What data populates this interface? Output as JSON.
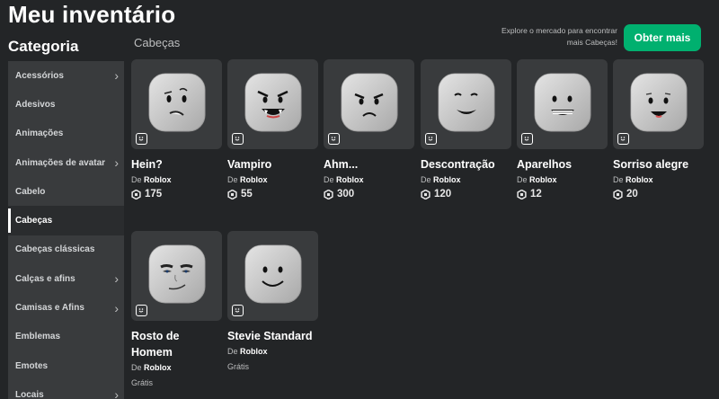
{
  "page": {
    "title": "Meu inventário"
  },
  "sidebar": {
    "title": "Categoria",
    "items": [
      {
        "label": "Acessórios",
        "chevron": true,
        "active": false
      },
      {
        "label": "Adesivos",
        "chevron": false,
        "active": false
      },
      {
        "label": "Animações",
        "chevron": false,
        "active": false
      },
      {
        "label": "Animações de avatar",
        "chevron": true,
        "active": false
      },
      {
        "label": "Cabelo",
        "chevron": false,
        "active": false
      },
      {
        "label": "Cabeças",
        "chevron": false,
        "active": true
      },
      {
        "label": "Cabeças clássicas",
        "chevron": false,
        "active": false
      },
      {
        "label": "Calças e afins",
        "chevron": true,
        "active": false
      },
      {
        "label": "Camisas e Afins",
        "chevron": true,
        "active": false
      },
      {
        "label": "Emblemas",
        "chevron": false,
        "active": false
      },
      {
        "label": "Emotes",
        "chevron": false,
        "active": false
      },
      {
        "label": "Locais",
        "chevron": true,
        "active": false
      }
    ]
  },
  "main": {
    "section_title": "Cabeças",
    "promo_text": "Explore o mercado para encontrar mais Cabeças!",
    "get_more_label": "Obter mais",
    "creator_prefix": "De",
    "items": [
      {
        "name": "Hein?",
        "creator": "Roblox",
        "price": "175",
        "face": "hein"
      },
      {
        "name": "Vampiro",
        "creator": "Roblox",
        "price": "55",
        "face": "vampiro"
      },
      {
        "name": "Ahm...",
        "creator": "Roblox",
        "price": "300",
        "face": "ahm"
      },
      {
        "name": "Descontração",
        "creator": "Roblox",
        "price": "120",
        "face": "descontracao"
      },
      {
        "name": "Aparelhos",
        "creator": "Roblox",
        "price": "12",
        "face": "aparelhos"
      },
      {
        "name": "Sorriso alegre",
        "creator": "Roblox",
        "price": "20",
        "face": "sorriso"
      },
      {
        "name": "Rosto de Homem",
        "creator": "Roblox",
        "price": "Grátis",
        "face": "homem"
      },
      {
        "name": "Stevie Standard",
        "creator": "Roblox",
        "price": "Grátis",
        "face": "stevie"
      }
    ]
  },
  "icons": {
    "sidebar_chevron": "chevron-right-icon",
    "robux": "robux-icon",
    "item_type": "head-item-icon"
  },
  "colors": {
    "accent": "#00b06f",
    "background": "#232527",
    "sidebar": "#393b3d",
    "card": "#393b3d"
  }
}
